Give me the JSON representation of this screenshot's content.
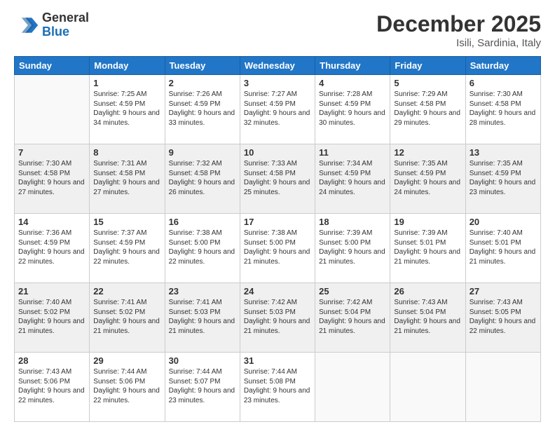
{
  "header": {
    "logo_general": "General",
    "logo_blue": "Blue",
    "month": "December 2025",
    "location": "Isili, Sardinia, Italy"
  },
  "weekdays": [
    "Sunday",
    "Monday",
    "Tuesday",
    "Wednesday",
    "Thursday",
    "Friday",
    "Saturday"
  ],
  "weeks": [
    [
      {
        "day": "",
        "sunrise": "",
        "sunset": "",
        "daylight": ""
      },
      {
        "day": "1",
        "sunrise": "Sunrise: 7:25 AM",
        "sunset": "Sunset: 4:59 PM",
        "daylight": "Daylight: 9 hours and 34 minutes."
      },
      {
        "day": "2",
        "sunrise": "Sunrise: 7:26 AM",
        "sunset": "Sunset: 4:59 PM",
        "daylight": "Daylight: 9 hours and 33 minutes."
      },
      {
        "day": "3",
        "sunrise": "Sunrise: 7:27 AM",
        "sunset": "Sunset: 4:59 PM",
        "daylight": "Daylight: 9 hours and 32 minutes."
      },
      {
        "day": "4",
        "sunrise": "Sunrise: 7:28 AM",
        "sunset": "Sunset: 4:59 PM",
        "daylight": "Daylight: 9 hours and 30 minutes."
      },
      {
        "day": "5",
        "sunrise": "Sunrise: 7:29 AM",
        "sunset": "Sunset: 4:58 PM",
        "daylight": "Daylight: 9 hours and 29 minutes."
      },
      {
        "day": "6",
        "sunrise": "Sunrise: 7:30 AM",
        "sunset": "Sunset: 4:58 PM",
        "daylight": "Daylight: 9 hours and 28 minutes."
      }
    ],
    [
      {
        "day": "7",
        "sunrise": "Sunrise: 7:30 AM",
        "sunset": "Sunset: 4:58 PM",
        "daylight": "Daylight: 9 hours and 27 minutes."
      },
      {
        "day": "8",
        "sunrise": "Sunrise: 7:31 AM",
        "sunset": "Sunset: 4:58 PM",
        "daylight": "Daylight: 9 hours and 27 minutes."
      },
      {
        "day": "9",
        "sunrise": "Sunrise: 7:32 AM",
        "sunset": "Sunset: 4:58 PM",
        "daylight": "Daylight: 9 hours and 26 minutes."
      },
      {
        "day": "10",
        "sunrise": "Sunrise: 7:33 AM",
        "sunset": "Sunset: 4:58 PM",
        "daylight": "Daylight: 9 hours and 25 minutes."
      },
      {
        "day": "11",
        "sunrise": "Sunrise: 7:34 AM",
        "sunset": "Sunset: 4:59 PM",
        "daylight": "Daylight: 9 hours and 24 minutes."
      },
      {
        "day": "12",
        "sunrise": "Sunrise: 7:35 AM",
        "sunset": "Sunset: 4:59 PM",
        "daylight": "Daylight: 9 hours and 24 minutes."
      },
      {
        "day": "13",
        "sunrise": "Sunrise: 7:35 AM",
        "sunset": "Sunset: 4:59 PM",
        "daylight": "Daylight: 9 hours and 23 minutes."
      }
    ],
    [
      {
        "day": "14",
        "sunrise": "Sunrise: 7:36 AM",
        "sunset": "Sunset: 4:59 PM",
        "daylight": "Daylight: 9 hours and 22 minutes."
      },
      {
        "day": "15",
        "sunrise": "Sunrise: 7:37 AM",
        "sunset": "Sunset: 4:59 PM",
        "daylight": "Daylight: 9 hours and 22 minutes."
      },
      {
        "day": "16",
        "sunrise": "Sunrise: 7:38 AM",
        "sunset": "Sunset: 5:00 PM",
        "daylight": "Daylight: 9 hours and 22 minutes."
      },
      {
        "day": "17",
        "sunrise": "Sunrise: 7:38 AM",
        "sunset": "Sunset: 5:00 PM",
        "daylight": "Daylight: 9 hours and 21 minutes."
      },
      {
        "day": "18",
        "sunrise": "Sunrise: 7:39 AM",
        "sunset": "Sunset: 5:00 PM",
        "daylight": "Daylight: 9 hours and 21 minutes."
      },
      {
        "day": "19",
        "sunrise": "Sunrise: 7:39 AM",
        "sunset": "Sunset: 5:01 PM",
        "daylight": "Daylight: 9 hours and 21 minutes."
      },
      {
        "day": "20",
        "sunrise": "Sunrise: 7:40 AM",
        "sunset": "Sunset: 5:01 PM",
        "daylight": "Daylight: 9 hours and 21 minutes."
      }
    ],
    [
      {
        "day": "21",
        "sunrise": "Sunrise: 7:40 AM",
        "sunset": "Sunset: 5:02 PM",
        "daylight": "Daylight: 9 hours and 21 minutes."
      },
      {
        "day": "22",
        "sunrise": "Sunrise: 7:41 AM",
        "sunset": "Sunset: 5:02 PM",
        "daylight": "Daylight: 9 hours and 21 minutes."
      },
      {
        "day": "23",
        "sunrise": "Sunrise: 7:41 AM",
        "sunset": "Sunset: 5:03 PM",
        "daylight": "Daylight: 9 hours and 21 minutes."
      },
      {
        "day": "24",
        "sunrise": "Sunrise: 7:42 AM",
        "sunset": "Sunset: 5:03 PM",
        "daylight": "Daylight: 9 hours and 21 minutes."
      },
      {
        "day": "25",
        "sunrise": "Sunrise: 7:42 AM",
        "sunset": "Sunset: 5:04 PM",
        "daylight": "Daylight: 9 hours and 21 minutes."
      },
      {
        "day": "26",
        "sunrise": "Sunrise: 7:43 AM",
        "sunset": "Sunset: 5:04 PM",
        "daylight": "Daylight: 9 hours and 21 minutes."
      },
      {
        "day": "27",
        "sunrise": "Sunrise: 7:43 AM",
        "sunset": "Sunset: 5:05 PM",
        "daylight": "Daylight: 9 hours and 22 minutes."
      }
    ],
    [
      {
        "day": "28",
        "sunrise": "Sunrise: 7:43 AM",
        "sunset": "Sunset: 5:06 PM",
        "daylight": "Daylight: 9 hours and 22 minutes."
      },
      {
        "day": "29",
        "sunrise": "Sunrise: 7:44 AM",
        "sunset": "Sunset: 5:06 PM",
        "daylight": "Daylight: 9 hours and 22 minutes."
      },
      {
        "day": "30",
        "sunrise": "Sunrise: 7:44 AM",
        "sunset": "Sunset: 5:07 PM",
        "daylight": "Daylight: 9 hours and 23 minutes."
      },
      {
        "day": "31",
        "sunrise": "Sunrise: 7:44 AM",
        "sunset": "Sunset: 5:08 PM",
        "daylight": "Daylight: 9 hours and 23 minutes."
      },
      {
        "day": "",
        "sunrise": "",
        "sunset": "",
        "daylight": ""
      },
      {
        "day": "",
        "sunrise": "",
        "sunset": "",
        "daylight": ""
      },
      {
        "day": "",
        "sunrise": "",
        "sunset": "",
        "daylight": ""
      }
    ]
  ]
}
